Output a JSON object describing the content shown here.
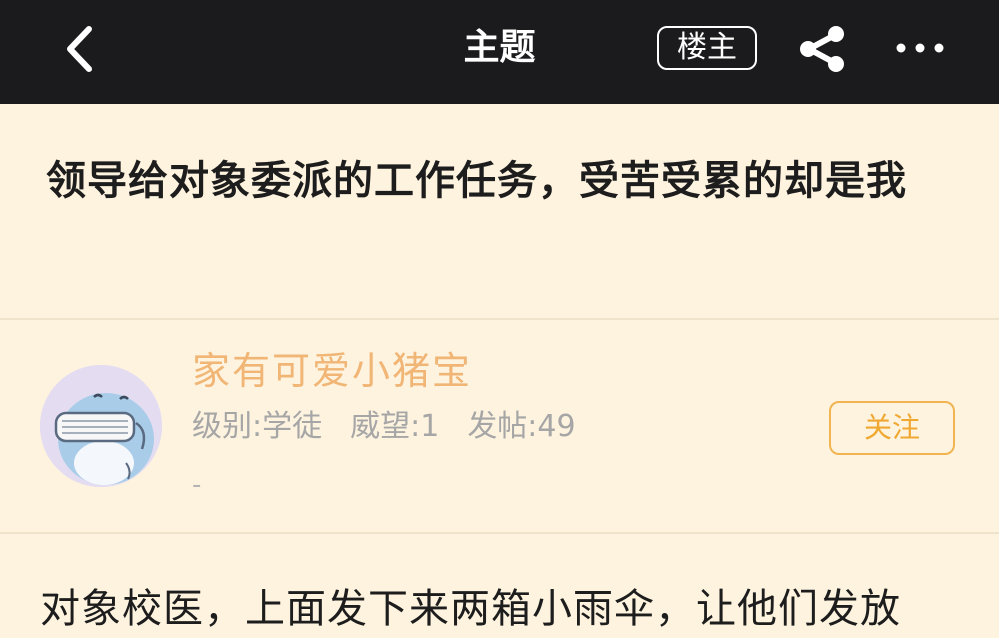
{
  "header": {
    "title": "主题",
    "owner_label": "楼主",
    "icons": {
      "back": "chevron-left-icon",
      "share": "share-icon",
      "more": "more-horizontal-icon"
    }
  },
  "post": {
    "title": "领导给对象委派的工作任务，受苦受累的却是我",
    "body": "对象校医，上面发下来两箱小雨伞，让他们发放"
  },
  "author": {
    "name": "家有可爱小猪宝",
    "level": "级别:学徒",
    "prestige": "威望:1",
    "posts": "发帖:49",
    "signature": "-",
    "follow_label": "关注"
  },
  "colors": {
    "header_bg": "#1b1b1d",
    "page_bg": "#fdf3df",
    "username": "#f1b575",
    "follow_accent": "#f2b451",
    "stats_text": "#a6a6a6"
  }
}
